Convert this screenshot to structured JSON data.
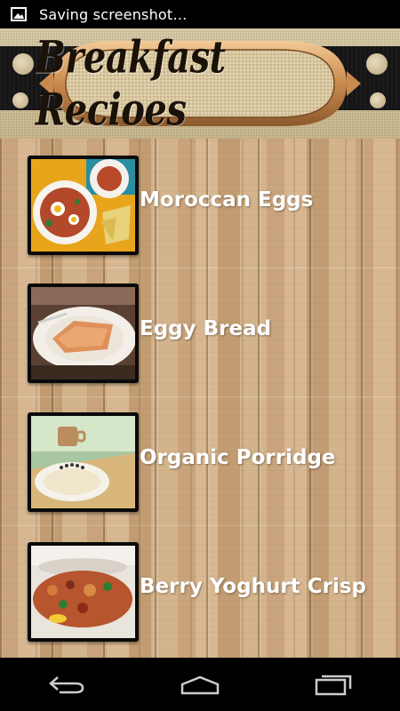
{
  "status_bar": {
    "notification_text": "Saving screenshot…",
    "icon": "image-icon"
  },
  "header": {
    "title": "Breakfast Recioes"
  },
  "recipes": [
    {
      "label": "Moroccan Eggs",
      "thumbnail": "moroccan-eggs-photo"
    },
    {
      "label": "Eggy Bread",
      "thumbnail": "eggy-bread-photo"
    },
    {
      "label": "Organic Porridge",
      "thumbnail": "organic-porridge-photo"
    },
    {
      "label": "Berry Yoghurt Crisp",
      "thumbnail": "berry-yoghurt-crisp-photo"
    }
  ],
  "nav_bar": {
    "back": "back-icon",
    "home": "home-icon",
    "recents": "recents-icon"
  },
  "colors": {
    "label_text": "#ffffff",
    "header_band": "#151515",
    "wood": "#cfad85"
  }
}
